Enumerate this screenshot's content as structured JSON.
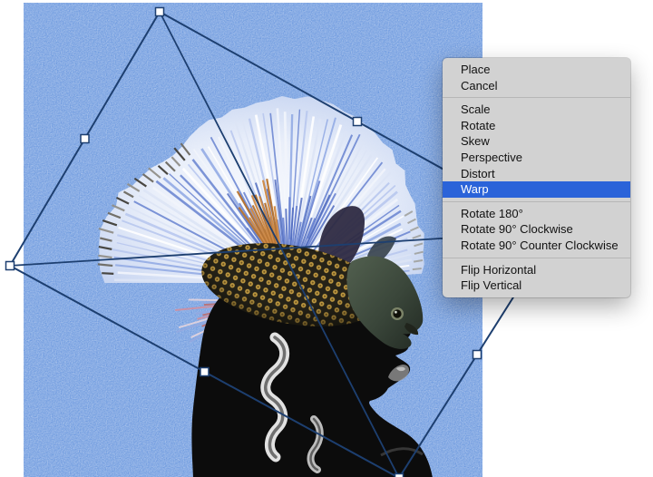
{
  "colors": {
    "canvas": "#6795dd",
    "menu-bg": "#d2d2d2",
    "menu-highlight": "#2b63d9",
    "line": "#1d3f70"
  },
  "menu": {
    "highlighted_item": "Warp",
    "groups": [
      {
        "items": [
          {
            "label": "Place"
          },
          {
            "label": "Cancel"
          }
        ]
      },
      {
        "items": [
          {
            "label": "Scale"
          },
          {
            "label": "Rotate"
          },
          {
            "label": "Skew"
          },
          {
            "label": "Perspective"
          },
          {
            "label": "Distort"
          },
          {
            "label": "Warp",
            "selected": true
          }
        ]
      },
      {
        "items": [
          {
            "label": "Rotate 180°"
          },
          {
            "label": "Rotate 90° Clockwise"
          },
          {
            "label": "Rotate 90° Counter Clockwise"
          }
        ]
      },
      {
        "items": [
          {
            "label": "Flip Horizontal"
          },
          {
            "label": "Flip Vertical"
          }
        ]
      }
    ]
  }
}
